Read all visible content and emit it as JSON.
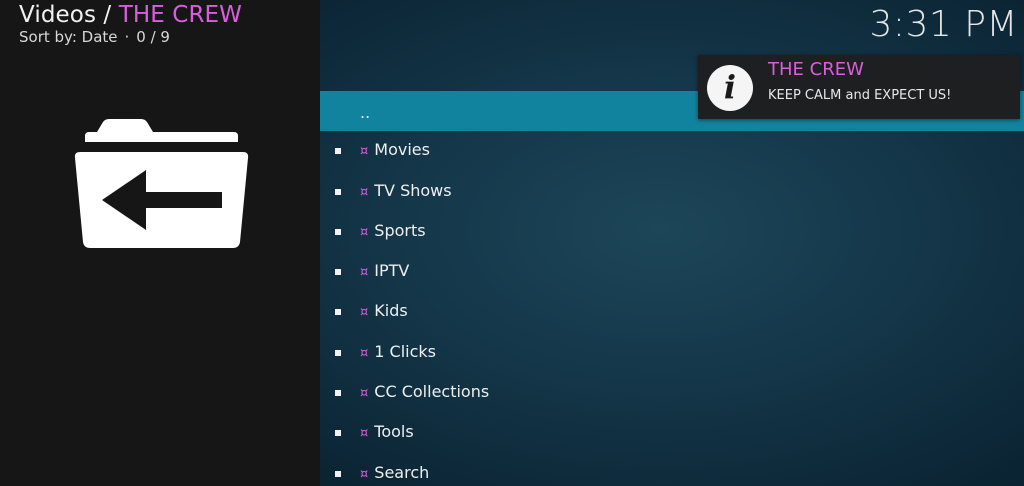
{
  "header": {
    "section": "Videos / ",
    "addon": "THE CREW",
    "sort_label": "Sort by: Date",
    "separator": "·",
    "position": "0 / 9"
  },
  "clock": "3:31 PM",
  "thumbnail": {
    "icon": "folder-back-icon"
  },
  "notification": {
    "icon": "info-icon",
    "glyph": "i",
    "title": "THE CREW",
    "message": "KEEP CALM and EXPECT US!"
  },
  "list": {
    "parent": "..",
    "items": [
      {
        "mark": "¤",
        "label": "Movies"
      },
      {
        "mark": "¤",
        "label": "TV Shows"
      },
      {
        "mark": "¤",
        "label": "Sports"
      },
      {
        "mark": "¤",
        "label": "IPTV"
      },
      {
        "mark": "¤",
        "label": "Kids"
      },
      {
        "mark": "¤",
        "label": "1 Clicks"
      },
      {
        "mark": "¤",
        "label": "CC Collections"
      },
      {
        "mark": "¤",
        "label": "Tools"
      },
      {
        "mark": "¤",
        "label": "Search"
      }
    ]
  },
  "colors": {
    "accent": "#d85fdc",
    "selection": "#12839f",
    "panel": "#161616"
  }
}
